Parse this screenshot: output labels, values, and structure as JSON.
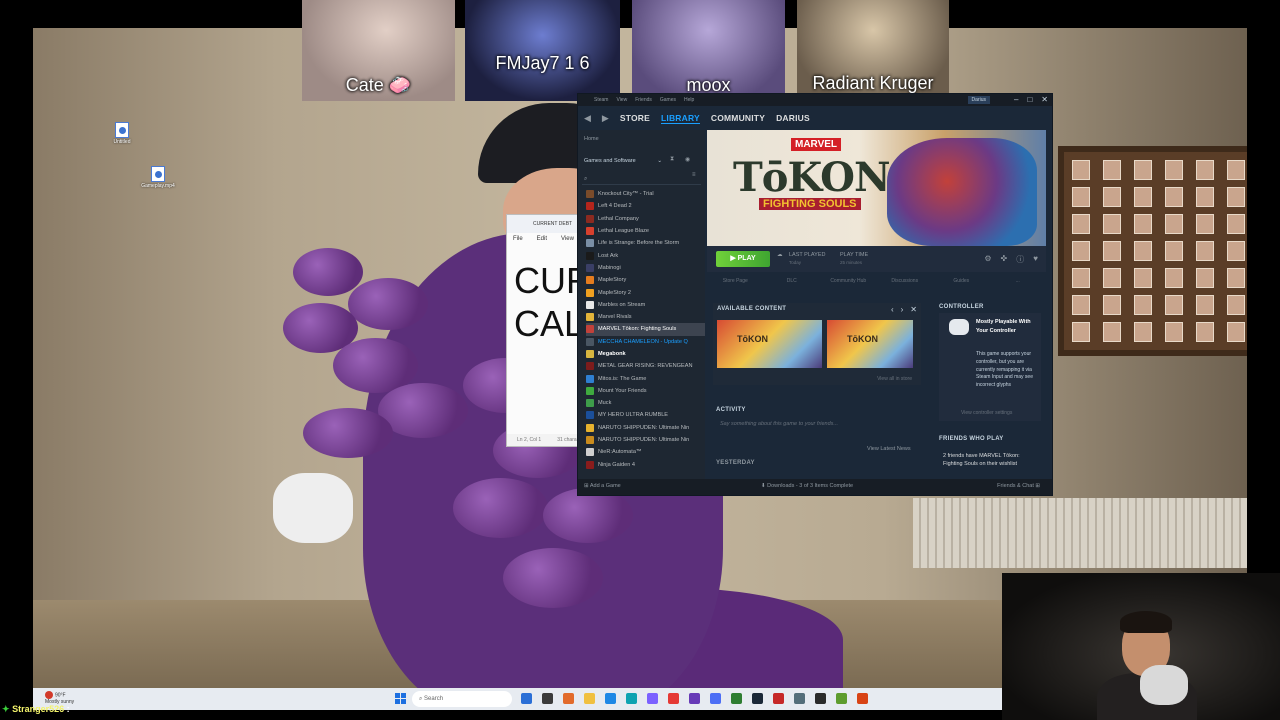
{
  "webcams": [
    {
      "name": "Cate 🧼"
    },
    {
      "name": "FMJay7  1 6"
    },
    {
      "name": "moox"
    },
    {
      "name": "Radiant Kruger"
    }
  ],
  "notepad": {
    "title": "CURRENT DEBT",
    "menu": [
      "File",
      "Edit",
      "View"
    ],
    "lines": [
      "CUR",
      "CAL"
    ],
    "status": [
      "Ln 2, Col 1",
      "31 chara"
    ]
  },
  "steam": {
    "topmenu": [
      "Steam",
      "View",
      "Friends",
      "Games",
      "Help"
    ],
    "account": "Darius",
    "nav_tabs": [
      "STORE",
      "LIBRARY",
      "COMMUNITY",
      "DARIUS"
    ],
    "active_tab": "LIBRARY",
    "home": "Home",
    "category": "Games and Software",
    "games": [
      {
        "name": "Knockout City™ - Trial",
        "color": "#7a4b2a"
      },
      {
        "name": "Left 4 Dead 2",
        "color": "#b5251c"
      },
      {
        "name": "Lethal Company",
        "color": "#8c2a20"
      },
      {
        "name": "Lethal League Blaze",
        "color": "#d8402d"
      },
      {
        "name": "Life is Strange: Before the Storm",
        "color": "#7a8ea5"
      },
      {
        "name": "Lost Ark",
        "color": "#1a1a1a"
      },
      {
        "name": "Mabinogi",
        "color": "#3a3f66"
      },
      {
        "name": "MapleStory",
        "color": "#e57c1e"
      },
      {
        "name": "MapleStory 2",
        "color": "#f0a020"
      },
      {
        "name": "Marbles on Stream",
        "color": "#e8e8e8"
      },
      {
        "name": "Marvel Rivals",
        "color": "#e3b43a"
      },
      {
        "name": "MARVEL Tōkon: Fighting Souls",
        "color": "#c2413a",
        "selected": true
      },
      {
        "name": "MECCHA CHAMELEON - Update Q",
        "color": "#4a5663",
        "update": true
      },
      {
        "name": "Megabonk",
        "color": "#d8b640",
        "bold": true
      },
      {
        "name": "METAL GEAR RISING: REVENGEAN",
        "color": "#7d1c1c"
      },
      {
        "name": "Mitos.is: The Game",
        "color": "#2f7fd1"
      },
      {
        "name": "Mount Your Friends",
        "color": "#3faa3f"
      },
      {
        "name": "Muck",
        "color": "#3e9d4a"
      },
      {
        "name": "MY HERO ULTRA RUMBLE",
        "color": "#1b4f9a"
      },
      {
        "name": "NARUTO SHIPPUDEN: Ultimate Nin",
        "color": "#e7b22e"
      },
      {
        "name": "NARUTO SHIPPUDEN: Ultimate Nin",
        "color": "#c98b1d"
      },
      {
        "name": "NieR:Automata™",
        "color": "#cfcfcf"
      },
      {
        "name": "Ninja Gaiden 4",
        "color": "#8a1c1c"
      }
    ],
    "hero": {
      "brand": "MARVEL",
      "logo": "TōKON",
      "subtitle": "FIGHTING SOULS"
    },
    "play": {
      "label": "PLAY",
      "last_played_label": "LAST PLAYED",
      "last_played_value": "Today",
      "play_time_label": "PLAY TIME",
      "play_time_value": "25 minutes"
    },
    "subnav": [
      "Store Page",
      "DLC",
      "Community Hub",
      "Discussions",
      "Guides",
      "..."
    ],
    "available_content": {
      "header": "AVAILABLE CONTENT",
      "view_all": "View all in store",
      "items": [
        {
          "label": "TōKON"
        },
        {
          "label": "TōKON"
        }
      ]
    },
    "activity": {
      "header": "ACTIVITY",
      "placeholder": "Say something about this game to your friends...",
      "latest": "View Latest News",
      "yesterday": "YESTERDAY"
    },
    "controller": {
      "header": "CONTROLLER",
      "title": "Mostly Playable With Your Controller",
      "desc": "This game supports your controller, but you are currently remapping it via Steam Input and may see incorrect glyphs",
      "link": "View controller settings"
    },
    "friends": {
      "header": "FRIENDS WHO PLAY",
      "text": "2 friends have MARVEL Tōkon: Fighting Souls on their wishlist"
    },
    "bottom": {
      "add_game": "Add a Game",
      "downloads": "Downloads - 3 of 3 Items Complete",
      "friends_chat": "Friends & Chat"
    }
  },
  "desktop_icons": [
    {
      "label": "Untitled"
    },
    {
      "label": "Gameplay.mp4"
    }
  ],
  "taskbar": {
    "weather_temp": "90°F",
    "weather_desc": "Mostly sunny",
    "search_placeholder": "Search"
  },
  "chat": {
    "star": "✦",
    "name": "Stranger526",
    "sep": ":"
  }
}
